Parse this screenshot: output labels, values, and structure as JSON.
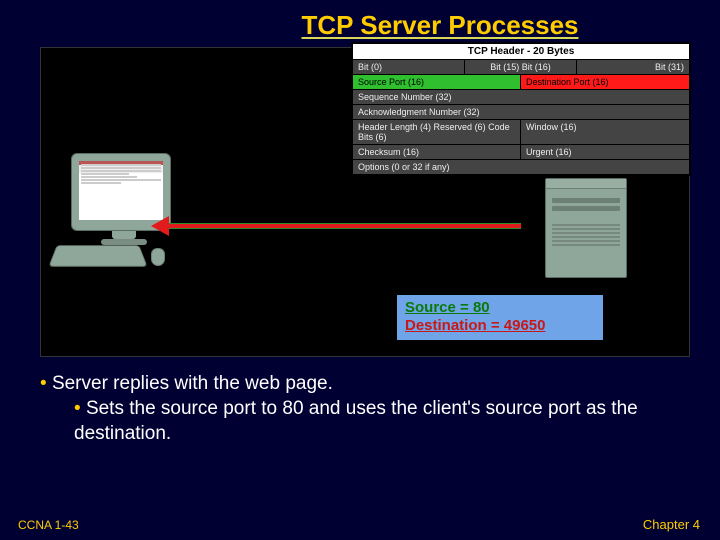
{
  "title": "TCP Server Processes",
  "tcpHeader": {
    "title": "TCP Header - 20 Bytes",
    "bits": {
      "b0": "Bit (0)",
      "b15": "Bit (15) Bit (16)",
      "b31": "Bit (31)"
    },
    "sourcePort": "Source Port (16)",
    "destPort": "Destination Port (16)",
    "seq": "Sequence Number (32)",
    "ack": "Acknowledgment Number (32)",
    "hlen": "Header Length (4) Reserved (6) Code Bits (6)",
    "window": "Window (16)",
    "checksum": "Checksum (16)",
    "urgent": "Urgent (16)",
    "options": "Options (0 or 32 if any)"
  },
  "portbox": {
    "source": "Source = 80",
    "dest": "Destination = 49650"
  },
  "bullets": {
    "l1": "Server replies with the web page.",
    "l2": "Sets the source port to 80 and uses the client's source port as the destination."
  },
  "footer": {
    "left": "CCNA 1-43",
    "right": "Chapter 4"
  }
}
